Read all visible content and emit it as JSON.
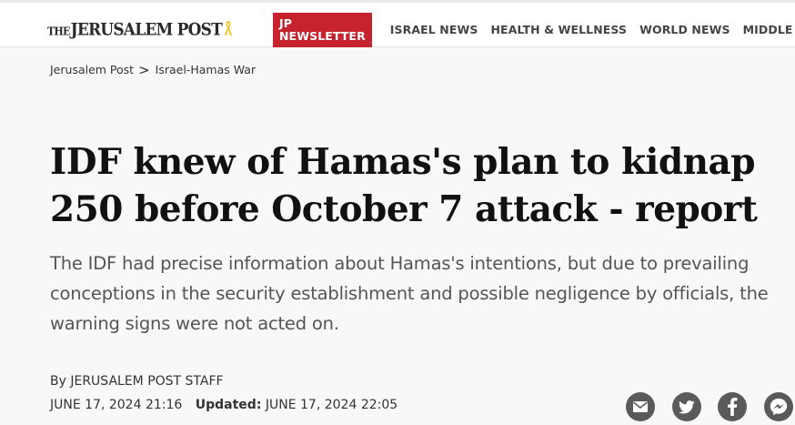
{
  "brand": {
    "logo_prefix": "THE",
    "logo_text": "JERUSALEM POST"
  },
  "nav": {
    "newsletter": "JP NEWSLETTER",
    "items": [
      "ISRAEL NEWS",
      "HEALTH & WELLNESS",
      "WORLD NEWS",
      "MIDDLE EAST"
    ]
  },
  "breadcrumb": {
    "home": "Jerusalem Post",
    "separator": ">",
    "section": "Israel-Hamas War"
  },
  "article": {
    "headline": "IDF knew of Hamas's plan to kidnap 250 before October 7 attack - report",
    "subtitle": "The IDF had precise information about Hamas's intentions, but due to prevailing conceptions in the security establishment and possible negligence by officials, the warning signs were not acted on.",
    "byline_prefix": "By",
    "author": "JERUSALEM POST STAFF",
    "published": "JUNE 17, 2024 21:16",
    "updated_label": "Updated:",
    "updated": "JUNE 17, 2024 22:05"
  },
  "share": {
    "icons": [
      "email-icon",
      "twitter-icon",
      "facebook-icon",
      "messenger-icon"
    ]
  },
  "colors": {
    "accent": "#c7232f",
    "share_bg": "#5a5a5a",
    "ribbon": "#f2c21b"
  }
}
